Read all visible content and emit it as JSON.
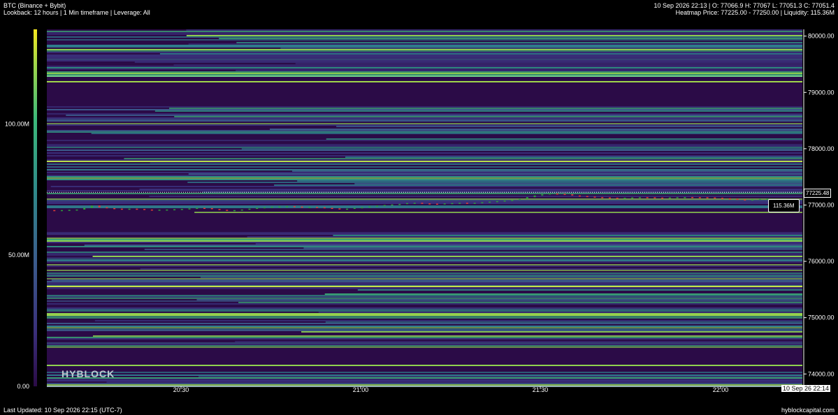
{
  "header": {
    "title": "BTC (Binance + Bybit)",
    "subtitle": "Lookback: 12 hours | 1 Min timeframe | Leverage: All",
    "ohlc": "10 Sep 2026 22:13 | O: 77066.9 H: 77067 L: 77051.3 C: 77051.4",
    "heatmap_info": "Heatmap Price: 77225.00 - 77250.00 | Liquidity: 115.36M"
  },
  "footer": {
    "last_updated": "Last Updated: 10 Sep 2026 22:15 (UTC-7)",
    "site": "hyblockcapital.com"
  },
  "logo": "HYBLOCK",
  "crosshair": {
    "price_label": "77225.48",
    "date_label": "10 Sep 26 22:14",
    "liquidity_label": "115.36M"
  },
  "chart_data": {
    "type": "heatmap",
    "y_axis": {
      "ticks": [
        "80000.00",
        "79000.00",
        "78000.00",
        "77000.00",
        "76000.00",
        "75000.00",
        "74000.00"
      ],
      "range": [
        73780,
        80120
      ]
    },
    "x_axis": {
      "ticks": [
        "20:30",
        "21:00",
        "21:30",
        "22:00"
      ]
    },
    "colorbar": {
      "ticks": [
        "100.00M",
        "50.00M",
        "0.00"
      ],
      "range": [
        0,
        136
      ]
    },
    "colors": {
      "background": "#2b0b47",
      "up": "#2e9e3a",
      "down": "#e53935"
    },
    "price_series": [
      76910,
      76900,
      76910,
      76915,
      76920,
      76950,
      76990,
      76960,
      76945,
      76935,
      76925,
      76935,
      76930,
      76920,
      76915,
      76918,
      76920,
      76925,
      76930,
      76940,
      76950,
      76945,
      76930,
      76915,
      76905,
      76910,
      76920,
      76935,
      76950,
      76960,
      76970,
      76975,
      76980,
      76972,
      76960,
      76965,
      76960,
      76950,
      76940,
      76930,
      76935,
      76950,
      76960,
      76975,
      76990,
      77000,
      77010,
      77020,
      77035,
      77040,
      77030,
      77025,
      77020,
      77030,
      77035,
      77040,
      77035,
      77040,
      77050,
      77060,
      77070,
      77080,
      77090,
      77110,
      77140,
      77170,
      77190,
      77205,
      77200,
      77190,
      77170,
      77160,
      77150,
      77140,
      77135,
      77130,
      77125,
      77130,
      77135,
      77140,
      77138,
      77132,
      77130,
      77135,
      77140,
      77142,
      77140,
      77138,
      77135,
      77128,
      77120,
      77110,
      77100,
      77095,
      77100,
      77110,
      77115
    ]
  }
}
